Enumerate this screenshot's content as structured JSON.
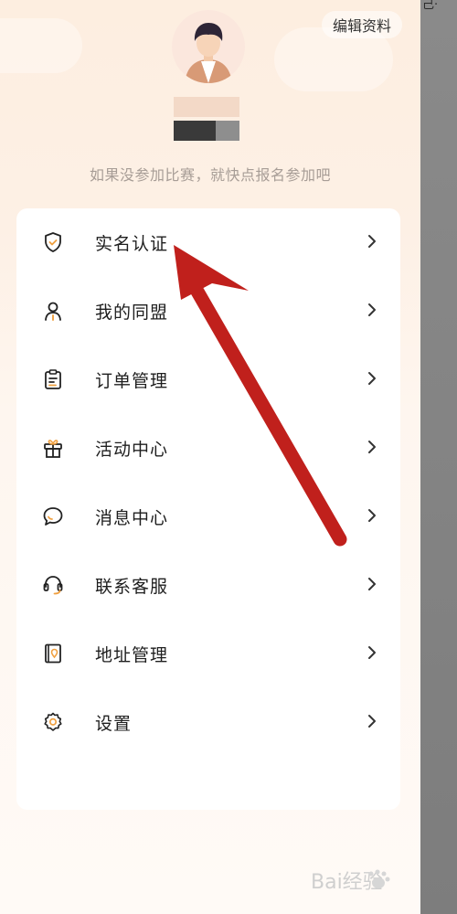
{
  "header": {
    "edit_profile_label": "编辑资料",
    "subtitle": "如果没参加比赛，就快点报名参加吧"
  },
  "menu": {
    "items": [
      {
        "label": "实名认证",
        "icon": "shield-check-icon"
      },
      {
        "label": "我的同盟",
        "icon": "person-icon"
      },
      {
        "label": "订单管理",
        "icon": "clipboard-icon"
      },
      {
        "label": "活动中心",
        "icon": "gift-icon"
      },
      {
        "label": "消息中心",
        "icon": "chat-bubble-icon"
      },
      {
        "label": "联系客服",
        "icon": "headset-icon"
      },
      {
        "label": "地址管理",
        "icon": "address-book-icon"
      },
      {
        "label": "设置",
        "icon": "gear-icon"
      }
    ]
  },
  "annotation": {
    "arrow_color": "#c0201c",
    "points_to": "实名认证"
  },
  "watermark": {
    "text": "Bai经验"
  },
  "colors": {
    "accent": "#f0a040",
    "background": "#fdf0e5"
  }
}
